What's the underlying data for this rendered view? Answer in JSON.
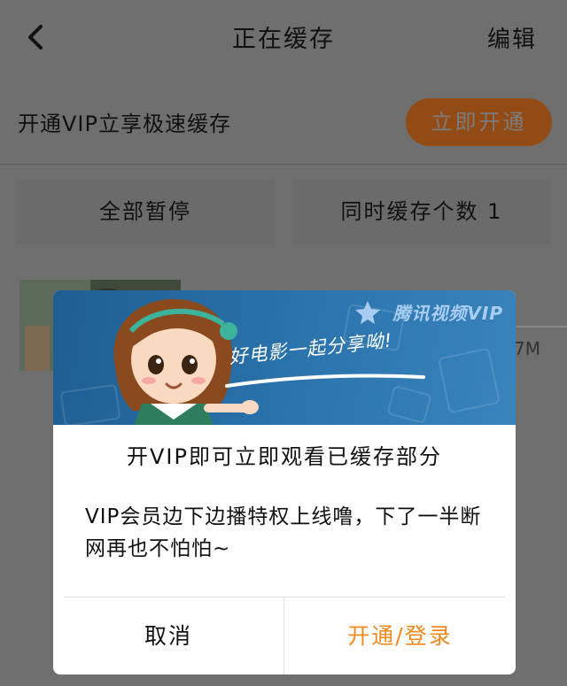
{
  "header": {
    "title": "正在缓存",
    "edit_label": "编辑",
    "back_icon": "chevron-left-icon"
  },
  "vip_bar": {
    "promo_text": "开通VIP立享极速缓存",
    "open_now_label": "立即开通"
  },
  "controls": {
    "pause_all_label": "全部暂停",
    "concurrent_label": "同时缓存个数 1"
  },
  "download_item": {
    "size_partial": "7M"
  },
  "dialog": {
    "banner": {
      "brand": "腾讯视频VIP",
      "slogan": "好电影一起分享呦!"
    },
    "title": "开VIP即可立即观看已缓存部分",
    "body": "VIP会员边下边播特权上线噜，下了一半断网再也不怕怕~",
    "cancel_label": "取消",
    "confirm_label": "开通/登录"
  },
  "colors": {
    "accent_orange": "#f08a1c",
    "dim_overlay": "#6f6f6f",
    "banner_blue": "#2b74ad"
  }
}
